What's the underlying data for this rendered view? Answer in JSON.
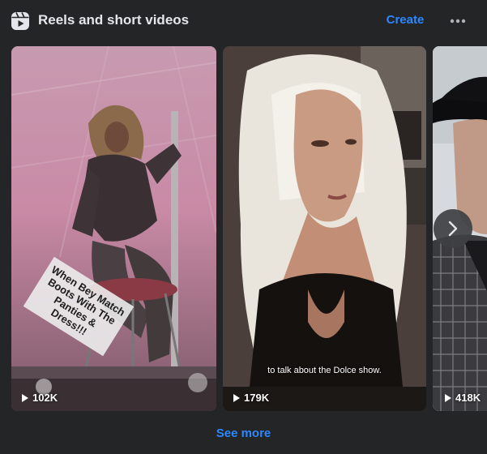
{
  "header": {
    "icon": "reels-icon",
    "title": "Reels and short videos",
    "create_label": "Create",
    "more_icon": "more-horizontal-icon"
  },
  "reels": [
    {
      "views": "102K",
      "overlay_text": "When Bey Match Boots With The Panties & Dress!!!",
      "subtitle": ""
    },
    {
      "views": "179K",
      "overlay_text": "",
      "subtitle": "to talk about the Dolce show."
    },
    {
      "views": "418K",
      "overlay_text": "",
      "subtitle": ""
    }
  ],
  "navigation": {
    "next_icon": "chevron-right-icon"
  },
  "footer": {
    "see_more_label": "See more"
  },
  "colors": {
    "card_background": "#242526",
    "title_text": "#e4e6eb",
    "link_blue": "#2d88ff"
  }
}
